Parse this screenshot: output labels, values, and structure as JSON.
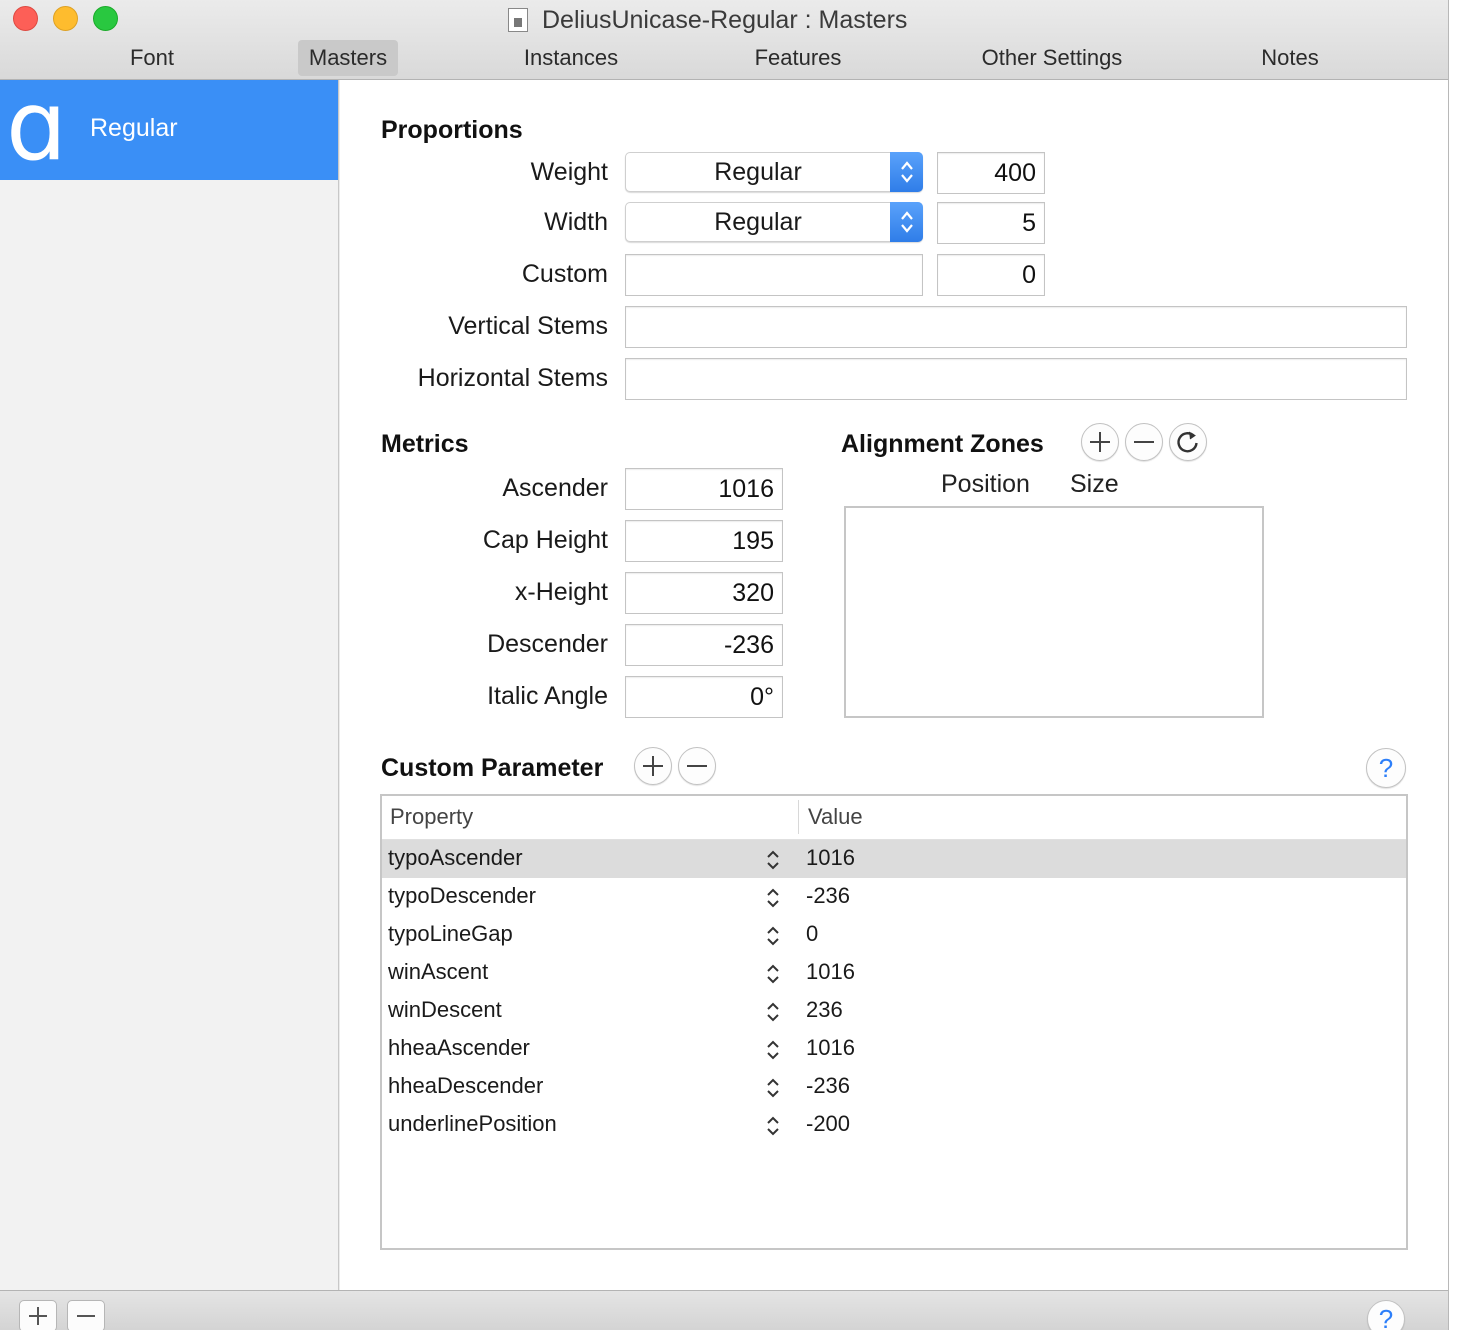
{
  "window": {
    "title": "DeliusUnicase-Regular : Masters"
  },
  "tabs": [
    {
      "label": "Font"
    },
    {
      "label": "Masters"
    },
    {
      "label": "Instances"
    },
    {
      "label": "Features"
    },
    {
      "label": "Other Settings"
    },
    {
      "label": "Notes"
    }
  ],
  "active_tab": "Masters",
  "sidebar": {
    "master": {
      "glyph": "ɑ",
      "name": "Regular"
    }
  },
  "proportions": {
    "heading": "Proportions",
    "weight": {
      "label": "Weight",
      "popup": "Regular",
      "value": "400"
    },
    "width": {
      "label": "Width",
      "popup": "Regular",
      "value": "5"
    },
    "custom": {
      "label": "Custom",
      "name": "",
      "value": "0"
    },
    "vertical_stems": {
      "label": "Vertical Stems",
      "value": ""
    },
    "horizontal_stems": {
      "label": "Horizontal Stems",
      "value": ""
    }
  },
  "metrics": {
    "heading": "Metrics",
    "ascender": {
      "label": "Ascender",
      "value": "1016"
    },
    "cap_height": {
      "label": "Cap Height",
      "value": "195"
    },
    "x_height": {
      "label": "x-Height",
      "value": "320"
    },
    "descender": {
      "label": "Descender",
      "value": "-236"
    },
    "italic_angle": {
      "label": "Italic Angle",
      "value": "0°"
    }
  },
  "alignment_zones": {
    "heading": "Alignment Zones",
    "col_position": "Position",
    "col_size": "Size",
    "zones": []
  },
  "custom_parameter": {
    "heading": "Custom Parameter",
    "col_property": "Property",
    "col_value": "Value",
    "rows": [
      {
        "property": "typoAscender",
        "value": "1016"
      },
      {
        "property": "typoDescender",
        "value": "-236"
      },
      {
        "property": "typoLineGap",
        "value": "0"
      },
      {
        "property": "winAscent",
        "value": "1016"
      },
      {
        "property": "winDescent",
        "value": "236"
      },
      {
        "property": "hheaAscender",
        "value": "1016"
      },
      {
        "property": "hheaDescender",
        "value": "-236"
      },
      {
        "property": "underlinePosition",
        "value": "-200"
      }
    ],
    "selected_row": 0
  },
  "icons": {
    "add": "plus-icon",
    "remove": "minus-icon",
    "refresh": "refresh-icon",
    "help": "help-icon",
    "stepper": "updown-chevron-icon"
  },
  "colors": {
    "selection_blue": "#3a8ff6",
    "popup_blue": "#2f7de8",
    "help_blue": "#2d7ff9"
  }
}
